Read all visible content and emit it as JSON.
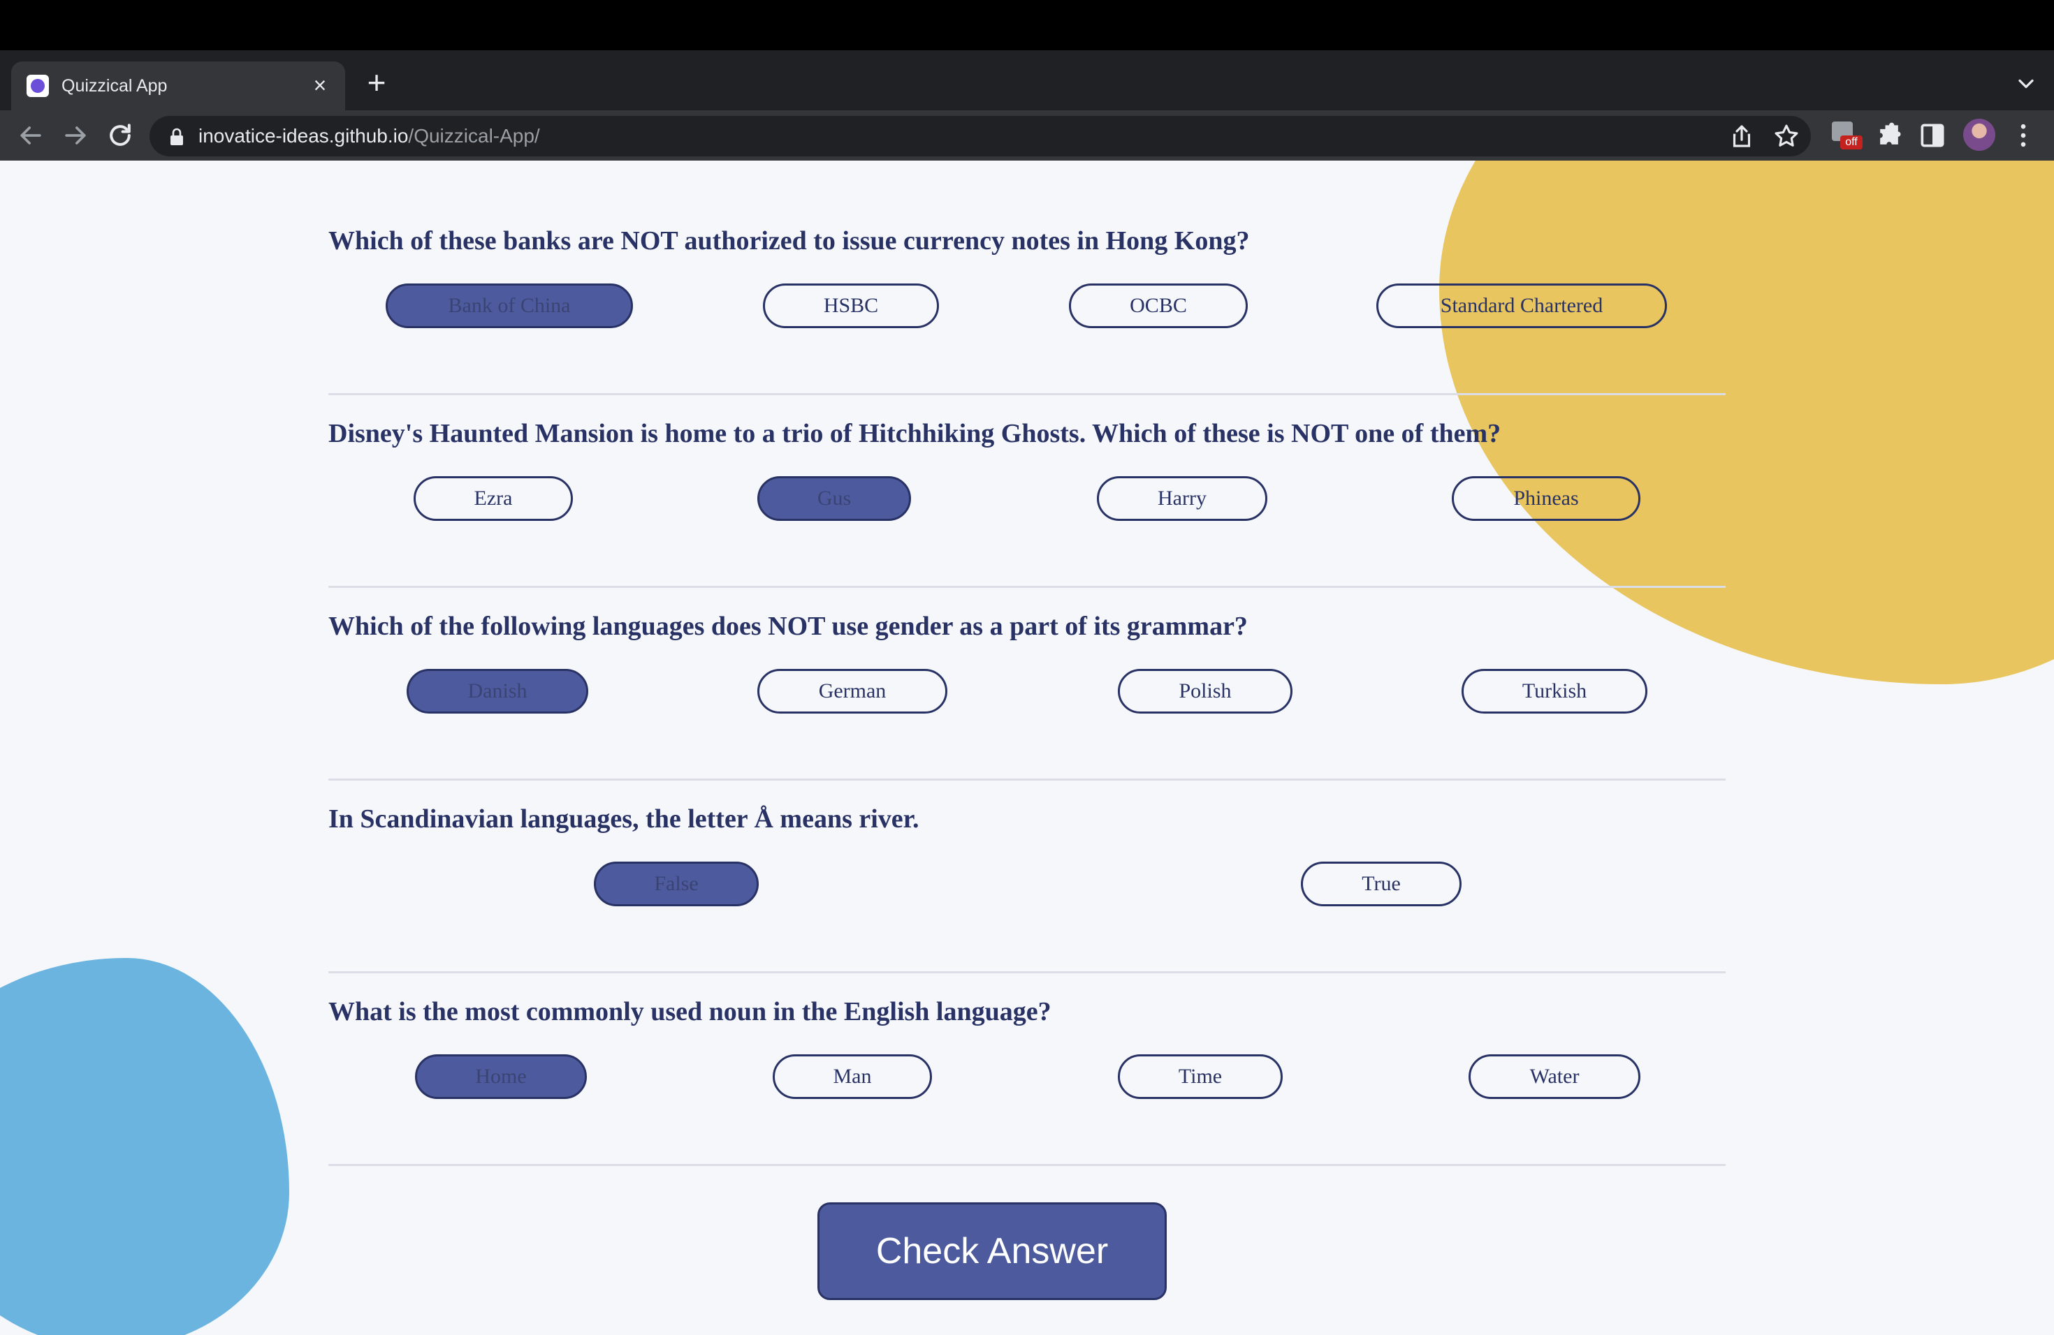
{
  "browser": {
    "tab_title": "Quizzical App",
    "tab_close_label": "×",
    "new_tab_label": "+",
    "url_host": "inovatice-ideas.github.io",
    "url_path": "/Quizzical-App/",
    "extension_badge": "off",
    "icons": [
      "back-arrow-icon",
      "forward-arrow-icon",
      "reload-icon",
      "lock-icon",
      "share-icon",
      "star-icon",
      "extension-icon",
      "puzzle-icon",
      "side-panel-icon",
      "menu-icon",
      "tab-list-icon"
    ]
  },
  "quiz": {
    "questions": [
      {
        "text": "Which of these banks are NOT authorized to issue currency notes in Hong Kong?",
        "answers": [
          "Bank of China",
          "HSBC",
          "OCBC",
          "Standard Chartered"
        ],
        "selected": "Bank of China"
      },
      {
        "text": "Disney's Haunted Mansion is home to a trio of Hitchhiking Ghosts. Which of these is NOT one of them?",
        "answers": [
          "Ezra",
          "Gus",
          "Harry",
          "Phineas"
        ],
        "selected": "Gus"
      },
      {
        "text": "Which of the following languages does NOT use gender as a part of its grammar?",
        "answers": [
          "Danish",
          "German",
          "Polish",
          "Turkish"
        ],
        "selected": "Danish"
      },
      {
        "text": "In Scandinavian languages, the letter Å means river.",
        "answers": [
          "False",
          "True"
        ],
        "selected": "False"
      },
      {
        "text": "What is the most commonly used noun in the English language?",
        "answers": [
          "Home",
          "Man",
          "Time",
          "Water"
        ],
        "selected": "Home"
      }
    ],
    "check_button_label": "Check Answer"
  },
  "colors": {
    "heading": "#293264",
    "selected_answer_bg": "#4d5b9e",
    "blob_yellow": "#e8c55e",
    "blob_blue": "#6cb4e0",
    "page_bg": "#f5f7fb"
  }
}
